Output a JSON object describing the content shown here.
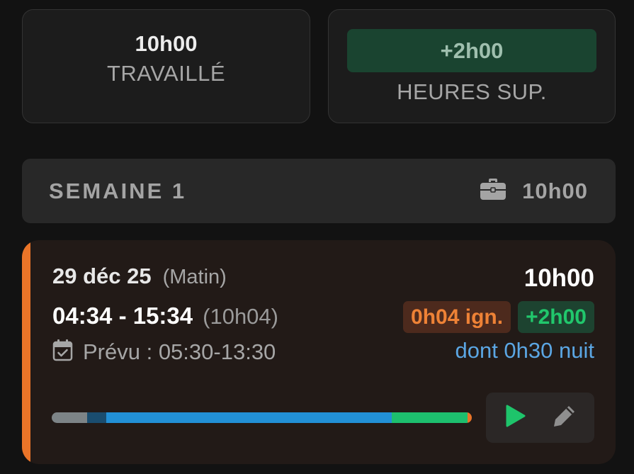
{
  "summary": {
    "worked": {
      "value": "10h00",
      "label": "TRAVAILLÉ"
    },
    "overtime": {
      "value": "+2h00",
      "label": "HEURES SUP."
    }
  },
  "week": {
    "title": "SEMAINE 1",
    "total": "10h00",
    "icon": "briefcase-icon"
  },
  "day": {
    "date": "29 déc 25",
    "shift": "(Matin)",
    "times": "04:34 - 15:34",
    "duration": "(10h04)",
    "planned": "Prévu : 05:30-13:30",
    "planned_icon": "calendar-check-icon",
    "total": "10h00",
    "ignored_badge": "0h04 ign.",
    "overtime_badge": "+2h00",
    "night": "dont 0h30 nuit",
    "progress_segments": [
      {
        "kind": "before-planned",
        "fraction": 0.085,
        "color": "#7d8487"
      },
      {
        "kind": "night",
        "fraction": 0.045,
        "color": "#1a4d6f"
      },
      {
        "kind": "regular",
        "fraction": 0.68,
        "color": "#2290d6"
      },
      {
        "kind": "overtime",
        "fraction": 0.18,
        "color": "#1dbf6e"
      },
      {
        "kind": "ignored",
        "fraction": 0.01,
        "color": "#ea7428"
      }
    ],
    "actions": {
      "play_icon": "play-icon",
      "edit_icon": "pencil-icon"
    }
  },
  "colors": {
    "accent": "#ea7428",
    "overtime_green": "#21c76c",
    "night_blue": "#5ba6e3"
  }
}
